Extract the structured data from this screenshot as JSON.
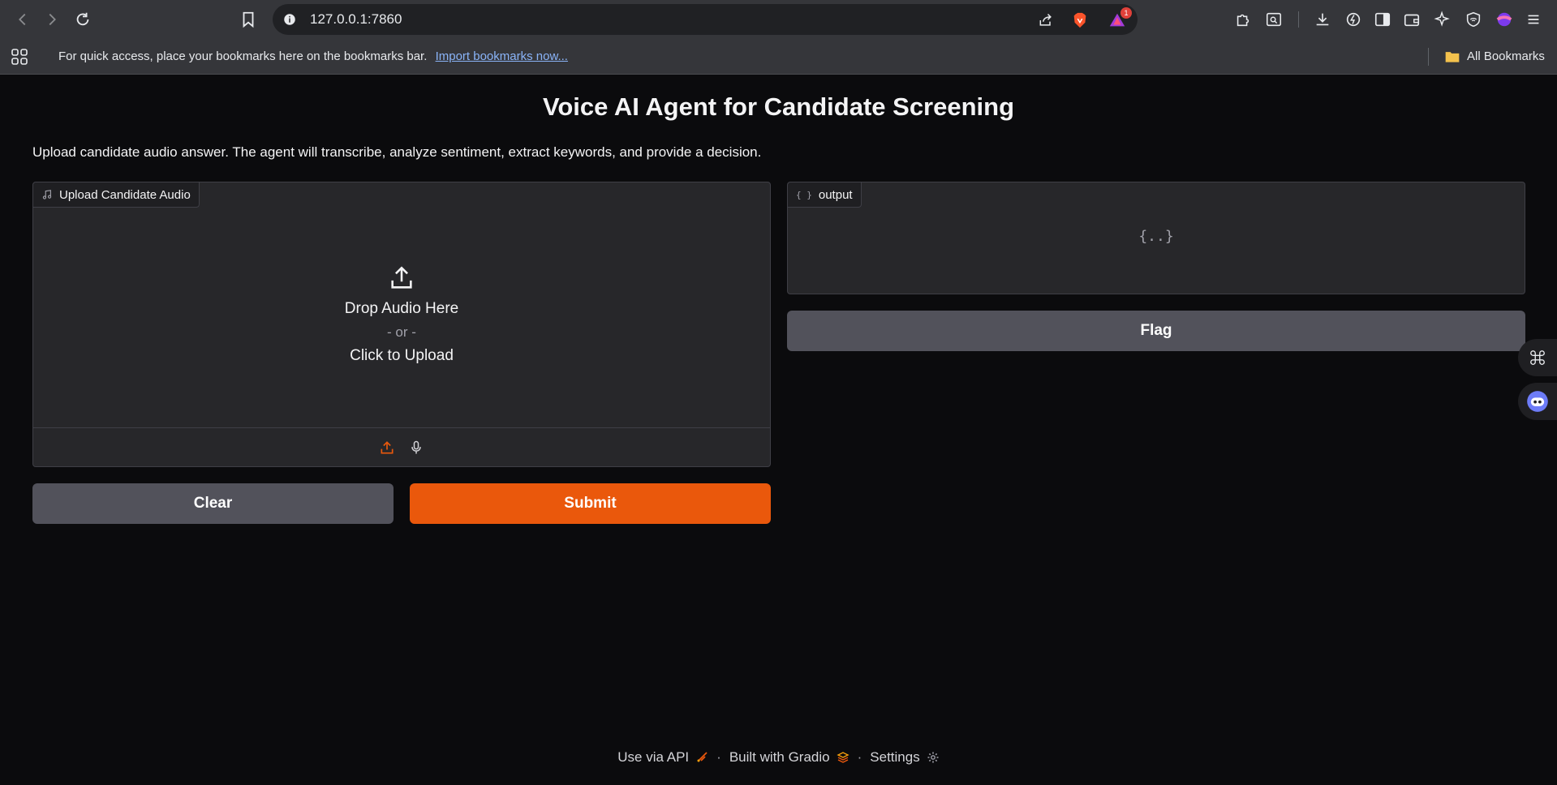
{
  "browser": {
    "url": "127.0.0.1:7860",
    "notification_count": "1",
    "bookmarks_bar": {
      "message": "For quick access, place your bookmarks here on the bookmarks bar.",
      "import_link": "Import bookmarks now...",
      "all_bookmarks": "All Bookmarks"
    }
  },
  "app": {
    "title": "Voice AI Agent for Candidate Screening",
    "description": "Upload candidate audio answer. The agent will transcribe, analyze sentiment, extract keywords, and provide a decision.",
    "audio_input": {
      "label": "Upload Candidate Audio",
      "drop_text": "Drop Audio Here",
      "or_text": "- or -",
      "click_text": "Click to Upload"
    },
    "output": {
      "label": "output",
      "empty_placeholder": "{..}"
    },
    "buttons": {
      "clear": "Clear",
      "submit": "Submit",
      "flag": "Flag"
    },
    "footer": {
      "api": "Use via API",
      "built_with": "Built with Gradio",
      "settings": "Settings"
    }
  },
  "colors": {
    "primary": "#ea580c",
    "secondary": "#52525b",
    "panel": "#27272a",
    "background": "#0b0b0d"
  }
}
